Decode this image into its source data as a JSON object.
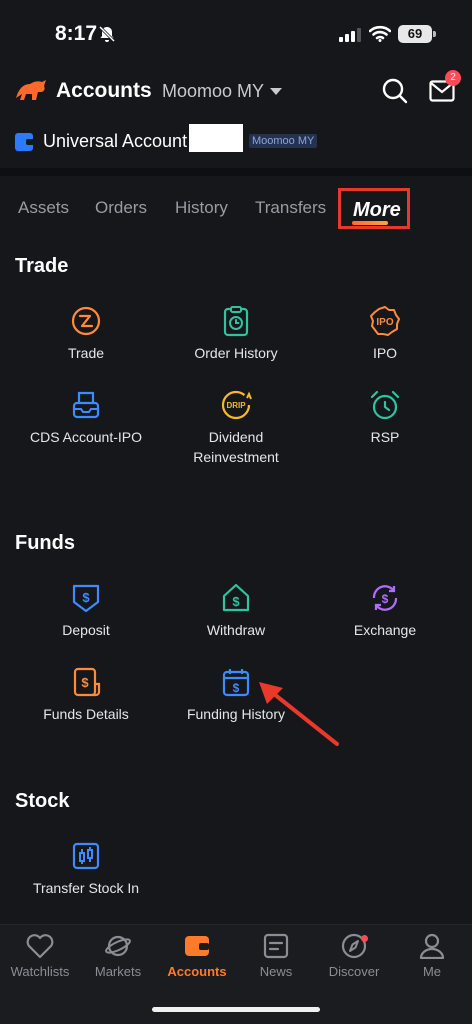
{
  "status_bar": {
    "time": "8:17",
    "battery": "69"
  },
  "header": {
    "title": "Accounts",
    "broker": "Moomoo MY",
    "mail_badge": "2"
  },
  "account": {
    "name": "Universal Account",
    "tag": "Moomoo MY"
  },
  "tabs": [
    "Assets",
    "Orders",
    "History",
    "Transfers",
    "More"
  ],
  "sections": {
    "trade": {
      "title": "Trade",
      "items": [
        "Trade",
        "Order History",
        "IPO",
        "CDS Account-IPO",
        "Dividend\nReinvestment",
        "RSP"
      ]
    },
    "funds": {
      "title": "Funds",
      "items": [
        "Deposit",
        "Withdraw",
        "Exchange",
        "Funds Details",
        "Funding History"
      ]
    },
    "stock": {
      "title": "Stock",
      "items": [
        "Transfer Stock In"
      ]
    }
  },
  "icon_text": {
    "ipo": "IPO",
    "drip": "DRIP"
  },
  "bottom_nav": [
    "Watchlists",
    "Markets",
    "Accounts",
    "News",
    "Discover",
    "Me"
  ],
  "colors": {
    "background": "#16171b",
    "accent": "#ff7a29",
    "highlight_box": "#e53a2a",
    "icon_orange": "#ff8a3c",
    "icon_teal": "#2ec4a0",
    "icon_blue": "#3d8bff",
    "icon_yellow": "#f5b82e",
    "icon_purple": "#b16cff"
  }
}
